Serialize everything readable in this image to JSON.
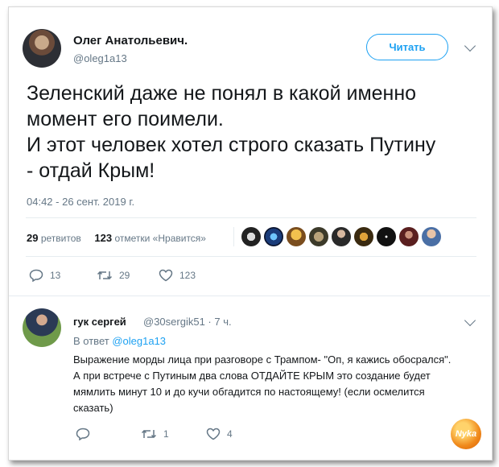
{
  "tweet": {
    "author_name": "Олег Анатольевич.",
    "author_handle": "@oleg1a13",
    "follow_label": "Читать",
    "text_lines": [
      "Зеленский даже не понял в какой именно",
      "момент его поимели.",
      "И этот человек хотел строго сказать Путину",
      "- отдай Крым!"
    ],
    "timestamp": "04:42 - 26 сент. 2019 г.",
    "retweets_count": "29",
    "retweets_label": "ретвитов",
    "likes_count": "123",
    "likes_label": "отметки «Нравится»",
    "reply_count": "13",
    "retweet_count": "29",
    "like_count": "123"
  },
  "reply": {
    "author_name": "гук сергей",
    "author_handle": "@30sergik51 · 7 ч.",
    "in_reply_prefix": "В ответ",
    "in_reply_handle": "@oleg1a13",
    "text_lines": [
      "Выражение морды лица при разговоре с Трампом- \"Оп, я кажись обосрался\".",
      "А при встрече с Путиным два слова ОТДАЙТЕ КРЫМ это создание  будет",
      "мямлить минут 10 и до кучи обгадится по настоящему! (если осмелится",
      "сказать)"
    ],
    "retweet_count": "1",
    "like_count": "4"
  },
  "watermark": {
    "text": "Nyka"
  },
  "colors": {
    "accent": "#1da1f2",
    "muted": "#657786",
    "text": "#14171a",
    "divider": "#e6ecf0"
  },
  "icons": [
    "avatar-photo",
    "chevron-down-icon",
    "reply-icon",
    "retweet-icon",
    "heart-icon"
  ]
}
